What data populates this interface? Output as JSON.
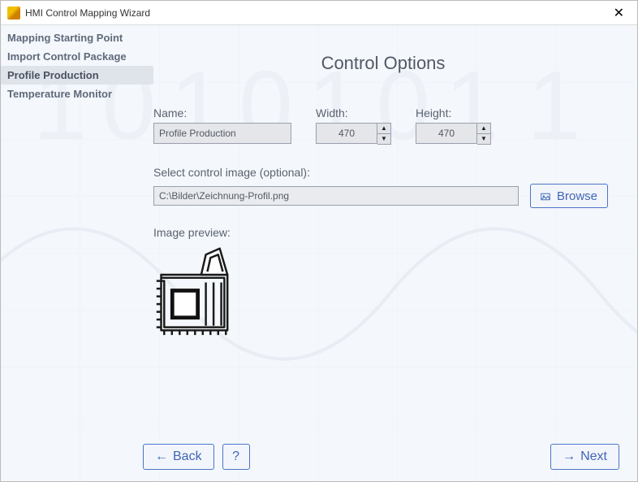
{
  "window": {
    "title": "HMI Control Mapping Wizard"
  },
  "sidebar": {
    "items": [
      {
        "label": "Mapping Starting Point",
        "active": false
      },
      {
        "label": "Import Control Package",
        "active": false
      },
      {
        "label": "Profile Production",
        "active": true
      },
      {
        "label": "Temperature Monitor",
        "active": false
      }
    ]
  },
  "main": {
    "heading": "Control Options",
    "name_label": "Name:",
    "name_value": "Profile Production",
    "width_label": "Width:",
    "width_value": "470",
    "height_label": "Height:",
    "height_value": "470",
    "select_image_label": "Select control image (optional):",
    "image_path": "C:\\Bilder\\Zeichnung-Profil.png",
    "browse_label": "Browse",
    "preview_label": "Image preview:"
  },
  "footer": {
    "back_label": "Back",
    "help_label": "?",
    "next_label": "Next"
  }
}
